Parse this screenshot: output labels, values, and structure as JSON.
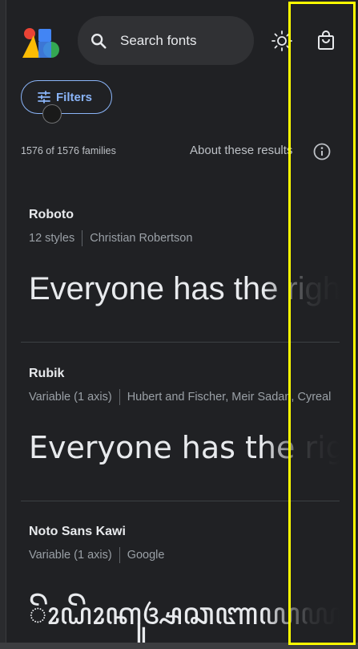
{
  "header": {
    "search_placeholder": "Search fonts"
  },
  "toolbar": {
    "filters_label": "Filters"
  },
  "results": {
    "count_text": "1576 of 1576 families",
    "about_label": "About these results"
  },
  "fonts": [
    {
      "name": "Roboto",
      "styles": "12 styles",
      "designer": "Christian Robertson",
      "sample": "Everyone has the right"
    },
    {
      "name": "Rubik",
      "styles": "Variable (1 axis)",
      "designer": "Hubert and Fischer, Meir Sadan, Cyreal",
      "sample": "Everyone has the right"
    },
    {
      "name": "Noto Sans Kawi",
      "styles": "Variable (1 axis)",
      "designer": "Google",
      "sample": "ꦼꦴꦝꦼꦴꦏꦸꦄꦕꦚꦪꦪꦴꦩ꧀ꦮ"
    }
  ],
  "colors": {
    "background": "#202124",
    "accent": "#8ab4f8",
    "highlight": "#ffff00"
  }
}
